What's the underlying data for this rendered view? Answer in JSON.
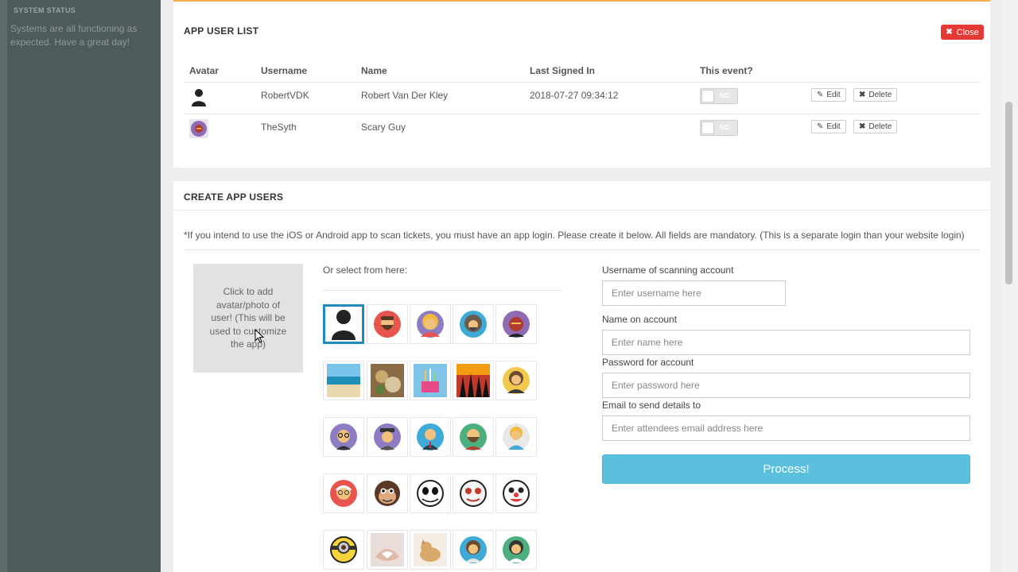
{
  "sidebar": {
    "status_heading": "SYSTEM STATUS",
    "status_text": "Systems are all functioning as expected. Have a great day!"
  },
  "user_list": {
    "title": "APP USER LIST",
    "close_label": "Close",
    "columns": [
      "Avatar",
      "Username",
      "Name",
      "Last Signed In",
      "This event?"
    ],
    "rows": [
      {
        "avatar": "person-silhouette-icon",
        "username": "RobertVDK",
        "name": "Robert Van Der Kley",
        "last_signed_in": "2018-07-27 09:34:12",
        "this_event": "NO",
        "edit": "Edit",
        "delete": "Delete"
      },
      {
        "avatar": "sith-avatar-icon",
        "username": "TheSyth",
        "name": "Scary Guy",
        "last_signed_in": "",
        "this_event": "NO",
        "edit": "Edit",
        "delete": "Delete"
      }
    ]
  },
  "create": {
    "title": "CREATE APP USERS",
    "note": "*If you intend to use the iOS or Android app to scan tickets, you must have an app login. Please create it below. All fields are mandatory. (This is a separate login than your website login)",
    "upload_text": "Click to add avatar/photo of user! (This will be used to customize the app)",
    "or_select": "Or select from here:",
    "avatars": [
      "person-silhouette-icon",
      "bearded-man-icon",
      "blonde-woman-icon",
      "hooded-man-icon",
      "sith-icon",
      "beach-photo-icon",
      "food-photo-icon",
      "cake-photo-icon",
      "party-photo-icon",
      "woman-avatar-icon",
      "glasses-man-icon",
      "hat-man-icon",
      "suit-man-icon",
      "beard-man-green-icon",
      "blonde-man-icon",
      "old-man-icon",
      "monkey-icon",
      "skeleton-icon",
      "doll-icon",
      "clown-icon",
      "minion-icon",
      "hands-photo-icon",
      "cat-photo-icon",
      "woman-blue-icon",
      "woman-green-icon"
    ],
    "fields": [
      {
        "label": "Username of scanning account",
        "placeholder": "Enter username here"
      },
      {
        "label": "Name on account",
        "placeholder": "Enter name here"
      },
      {
        "label": "Password for account",
        "placeholder": "Enter password here"
      },
      {
        "label": "Email to send details to",
        "placeholder": "Enter attendees email address here"
      }
    ],
    "process_label": "Process!"
  },
  "colors": {
    "accent": "#5bc0de",
    "close": "#e53935",
    "selected_border": "#1e88c7",
    "top_border": "#f0ad4e"
  }
}
